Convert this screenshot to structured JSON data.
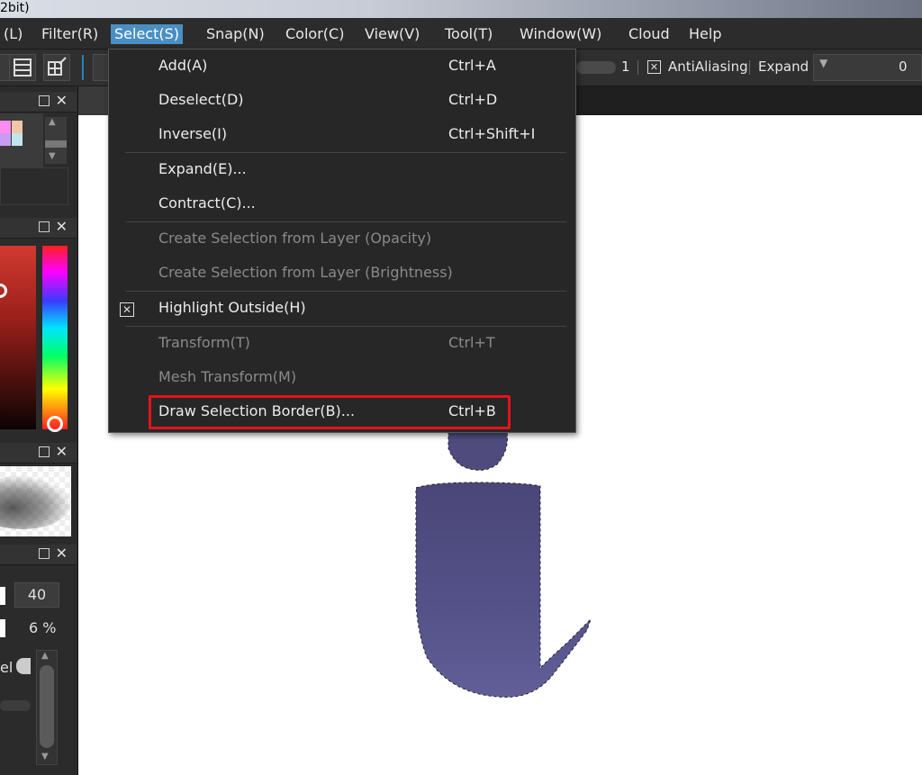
{
  "title": {
    "text": "2bit)"
  },
  "menubar": {
    "items": [
      {
        "label": "(L)",
        "key": "layer"
      },
      {
        "label": "Filter(R)",
        "key": "filter"
      },
      {
        "label": "Select(S)",
        "key": "select"
      },
      {
        "label": "Snap(N)",
        "key": "snap"
      },
      {
        "label": "Color(C)",
        "key": "color"
      },
      {
        "label": "View(V)",
        "key": "view"
      },
      {
        "label": "Tool(T)",
        "key": "tool"
      },
      {
        "label": "Window(W)",
        "key": "window"
      },
      {
        "label": "Cloud",
        "key": "cloud"
      },
      {
        "label": "Help",
        "key": "help"
      }
    ],
    "active": "select"
  },
  "toolbar": {
    "width_value": "1",
    "antialiasing_label": "AntiAliasing",
    "antialiasing_checked": true,
    "expand_label": "Expand",
    "expand_value": "0"
  },
  "select_menu": {
    "items": [
      {
        "label": "Add(A)",
        "shortcut": "Ctrl+A",
        "enabled": true
      },
      {
        "label": "Deselect(D)",
        "shortcut": "Ctrl+D",
        "enabled": true
      },
      {
        "label": "Inverse(I)",
        "shortcut": "Ctrl+Shift+I",
        "enabled": true
      },
      {
        "label": "Expand(E)...",
        "shortcut": "",
        "enabled": true
      },
      {
        "label": "Contract(C)...",
        "shortcut": "",
        "enabled": true
      },
      {
        "label": "Create Selection from Layer (Opacity)",
        "shortcut": "",
        "enabled": false
      },
      {
        "label": "Create Selection from Layer (Brightness)",
        "shortcut": "",
        "enabled": false
      },
      {
        "label": "Highlight Outside(H)",
        "shortcut": "",
        "enabled": true,
        "checked": true
      },
      {
        "label": "Transform(T)",
        "shortcut": "Ctrl+T",
        "enabled": false
      },
      {
        "label": "Mesh Transform(M)",
        "shortcut": "",
        "enabled": false
      },
      {
        "label": "Draw Selection Border(B)...",
        "shortcut": "Ctrl+B",
        "enabled": true,
        "highlighted": true
      }
    ]
  },
  "brush_panel": {
    "size_value": "40",
    "opacity_value": "6 %",
    "partial_label": "el"
  },
  "colors": {
    "accent": "#4a8fc4",
    "highlight_border": "#e3141a",
    "figure_fill": "#4f4b7c"
  }
}
